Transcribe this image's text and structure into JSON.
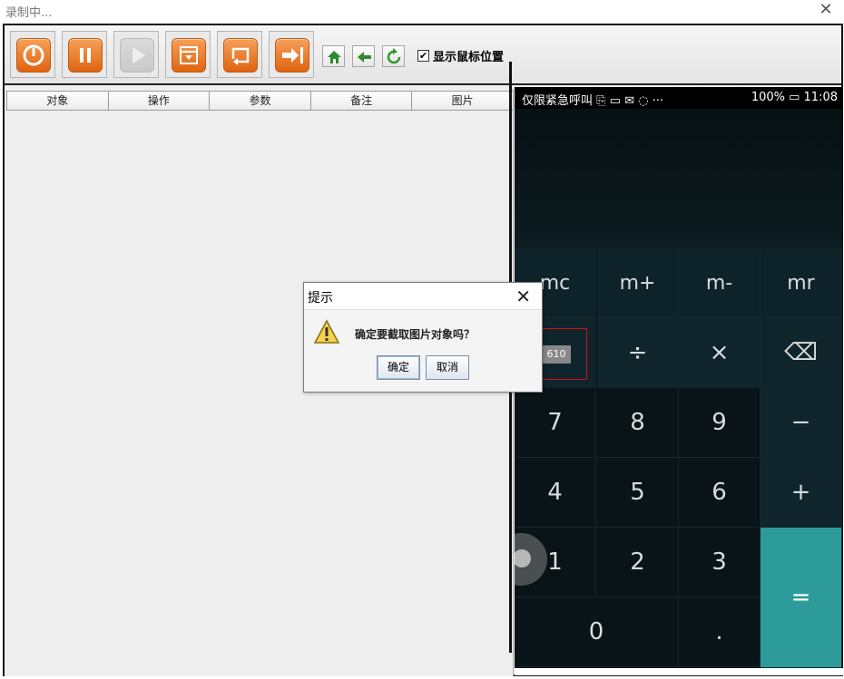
{
  "window": {
    "title": "录制中...",
    "close_glyph": "✕"
  },
  "toolbar": {
    "buttons": [
      {
        "name": "power-icon",
        "enabled": true
      },
      {
        "name": "pause-icon",
        "enabled": true
      },
      {
        "name": "play-icon",
        "enabled": false
      },
      {
        "name": "download-icon",
        "enabled": true
      },
      {
        "name": "loop-icon",
        "enabled": true
      },
      {
        "name": "skip-end-icon",
        "enabled": true
      }
    ],
    "small_buttons": [
      "home-icon",
      "back-arrow-icon",
      "refresh-icon"
    ],
    "show_mouse_checkbox": {
      "label": "显示鼠标位置",
      "checked": true
    }
  },
  "table": {
    "columns": [
      "对象",
      "操作",
      "参数",
      "备注",
      "图片"
    ]
  },
  "phone": {
    "status_left": "仅限紧急呼叫 ⎘ ▭ ✉ ◌ ···",
    "status_right": "100% ▭ 11:08",
    "overlay_label": "610",
    "keys": [
      [
        "mc",
        "m+",
        "m-",
        "mr"
      ],
      [
        "",
        "÷",
        "×",
        "⌫"
      ],
      [
        "7",
        "8",
        "9",
        "−"
      ],
      [
        "4",
        "5",
        "6",
        "+"
      ],
      [
        "1",
        "2",
        "3",
        "="
      ],
      [
        "0",
        "",
        ".",
        ""
      ]
    ]
  },
  "dialog": {
    "title": "提示",
    "close_glyph": "✕",
    "message": "确定要截取图片对象吗？",
    "ok_label": "确定",
    "cancel_label": "取消"
  },
  "colors": {
    "accent_orange": "#e06410",
    "equals_teal": "#2e9b9b",
    "phone_bg": "#081114"
  }
}
